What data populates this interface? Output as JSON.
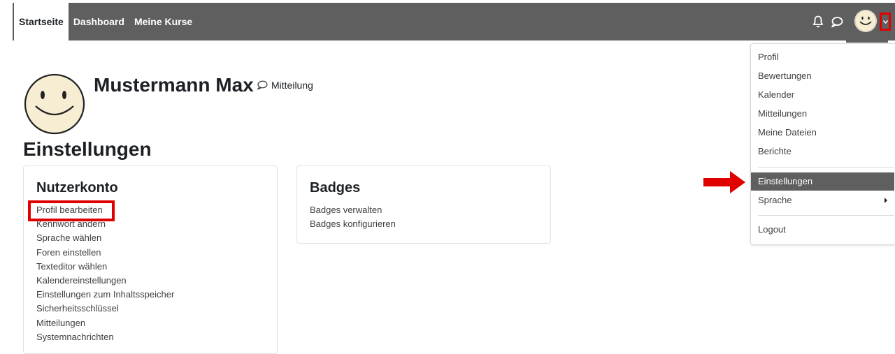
{
  "navbar": {
    "tabs": [
      {
        "label": "Startseite",
        "active": true
      },
      {
        "label": "Dashboard",
        "active": false
      },
      {
        "label": "Meine Kurse",
        "active": false
      }
    ],
    "icons": [
      "bell-icon",
      "chat-icon",
      "avatar",
      "chevron-down-icon"
    ]
  },
  "profile": {
    "name": "Mustermann Max",
    "message_link": "Mitteilung"
  },
  "page": {
    "title": "Einstellungen"
  },
  "account_card": {
    "title": "Nutzerkonto",
    "links": [
      "Profil bearbeiten",
      "Kennwort ändern",
      "Sprache wählen",
      "Foren einstellen",
      "Texteditor wählen",
      "Kalendereinstellungen",
      "Einstellungen zum Inhaltsspeicher",
      "Sicherheitsschlüssel",
      "Mitteilungen",
      "Systemnachrichten"
    ]
  },
  "badges_card": {
    "title": "Badges",
    "links": [
      "Badges verwalten",
      "Badges konfigurieren"
    ]
  },
  "user_menu": {
    "items": [
      "Profil",
      "Bewertungen",
      "Kalender",
      "Mitteilungen",
      "Meine Dateien",
      "Berichte",
      "Einstellungen",
      "Sprache",
      "Logout"
    ],
    "active_item": "Einstellungen"
  },
  "colors": {
    "navbar": "#5f5f5f",
    "annotation_red": "#e00000",
    "active_menu": "#5f5f5f"
  }
}
